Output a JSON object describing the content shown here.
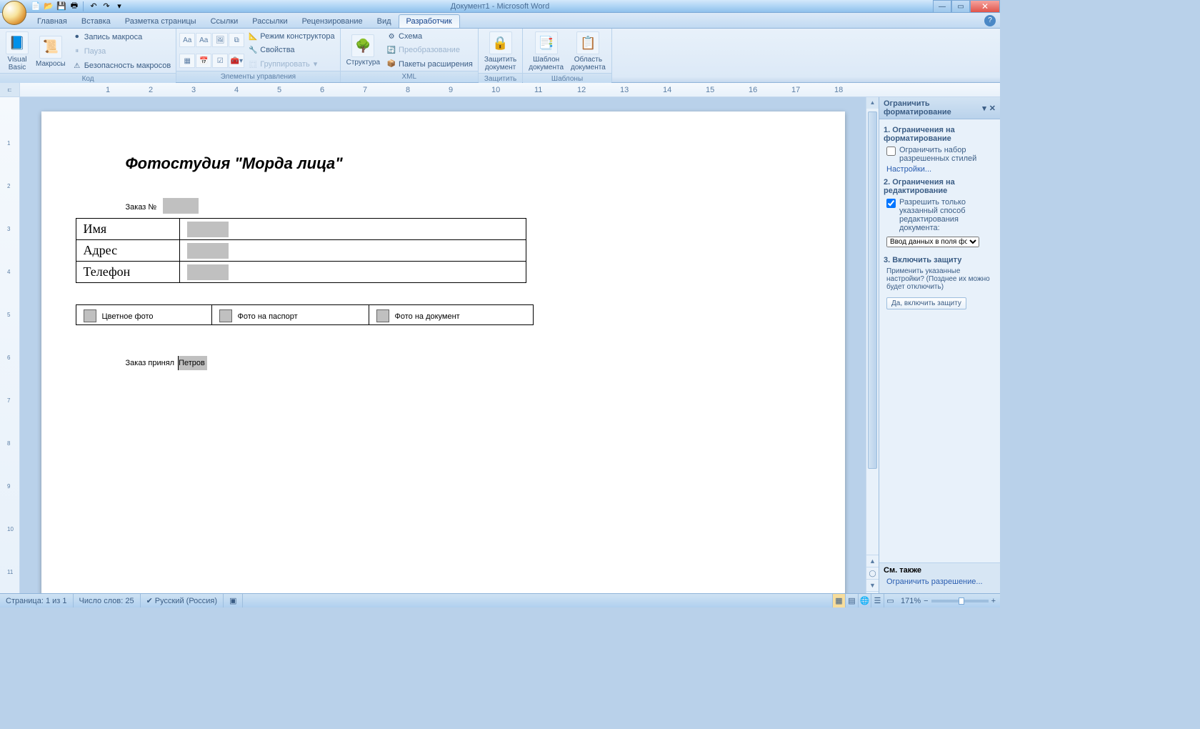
{
  "titlebar": {
    "title": "Документ1 - Microsoft Word"
  },
  "tabs": {
    "t0": "Главная",
    "t1": "Вставка",
    "t2": "Разметка страницы",
    "t3": "Ссылки",
    "t4": "Рассылки",
    "t5": "Рецензирование",
    "t6": "Вид",
    "t7": "Разработчик"
  },
  "ribbon": {
    "g1": {
      "vb": "Visual\nBasic",
      "mac": "Макросы",
      "rec": "Запись макроса",
      "pause": "Пауза",
      "sec": "Безопасность макросов",
      "label": "Код"
    },
    "g2": {
      "designer": "Режим конструктора",
      "props": "Свойства",
      "group": "Группировать",
      "label": "Элементы управления"
    },
    "g3": {
      "struct": "Структура",
      "schema": "Схема",
      "trans": "Преобразование",
      "packs": "Пакеты расширения",
      "label": "XML"
    },
    "g4": {
      "protect": "Защитить\nдокумент",
      "label": "Защитить"
    },
    "g5": {
      "tmpl": "Шаблон\nдокумента",
      "area": "Область\nдокумента",
      "label": "Шаблоны"
    }
  },
  "document": {
    "title": "Фотостудия \"Морда лица\"",
    "order_label": "Заказ №",
    "rows": {
      "r0": "Имя",
      "r1": "Адрес",
      "r2": "Телефон"
    },
    "opts": {
      "o0": "Цветное фото",
      "o1": "Фото на паспорт",
      "o2": "Фото на документ"
    },
    "accepted": "Заказ принял",
    "person": "Петров"
  },
  "taskpane": {
    "header": "Ограничить форматирование",
    "h1": "1. Ограничения на форматирование",
    "chk1": "Ограничить набор разрешенных стилей",
    "link1": "Настройки...",
    "h2": "2. Ограничения на редактирование",
    "chk2": "Разрешить только указанный способ редактирования документа:",
    "select": "Ввод данных в поля форм",
    "h3": "3. Включить защиту",
    "note": "Применить указанные настройки? (Позднее их можно будет отключить)",
    "btn": "Да, включить защиту",
    "footer_h": "См. также",
    "footer_link": "Ограничить разрешение..."
  },
  "statusbar": {
    "page": "Страница: 1 из 1",
    "words": "Число слов: 25",
    "lang": "Русский (Россия)",
    "zoom": "171%"
  }
}
